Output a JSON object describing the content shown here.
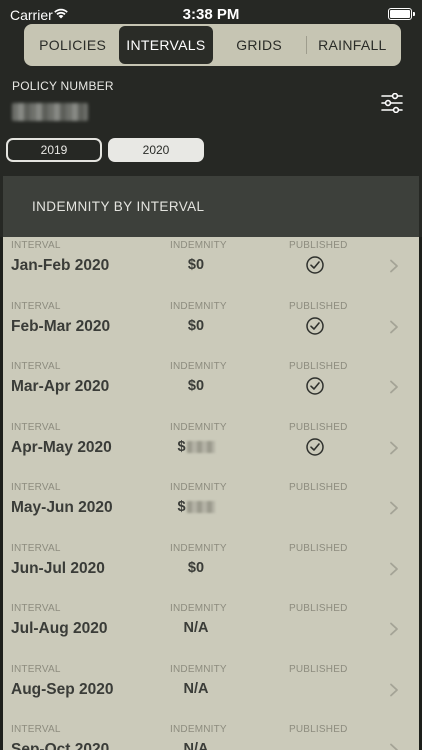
{
  "status_bar": {
    "carrier": "Carrier",
    "time": "3:38 PM"
  },
  "tabs": [
    {
      "label": "POLICIES",
      "active": false
    },
    {
      "label": "INTERVALS",
      "active": true
    },
    {
      "label": "GRIDS",
      "active": false
    },
    {
      "label": "RAINFALL",
      "active": false
    }
  ],
  "policy": {
    "label": "POLICY NUMBER",
    "value_icon": "redacted-text"
  },
  "years": [
    {
      "label": "2019",
      "selected": false
    },
    {
      "label": "2020",
      "selected": true
    }
  ],
  "section_title": "INDEMNITY BY INTERVAL",
  "columns": {
    "interval": "INTERVAL",
    "indemnity": "INDEMNITY",
    "published": "PUBLISHED"
  },
  "rows": [
    {
      "period": "Jan-Feb 2020",
      "indemnity": "$0",
      "published": true
    },
    {
      "period": "Feb-Mar 2020",
      "indemnity": "$0",
      "published": true
    },
    {
      "period": "Mar-Apr 2020",
      "indemnity": "$0",
      "published": true
    },
    {
      "period": "Apr-May 2020",
      "indemnity": "$",
      "redacted": true,
      "published": true
    },
    {
      "period": "May-Jun 2020",
      "indemnity": "$",
      "redacted": true,
      "published": false
    },
    {
      "period": "Jun-Jul 2020",
      "indemnity": "$0",
      "published": false
    },
    {
      "period": "Jul-Aug 2020",
      "indemnity": "N/A",
      "published": false
    },
    {
      "period": "Aug-Sep 2020",
      "indemnity": "N/A",
      "published": false
    },
    {
      "period": "Sep-Oct 2020",
      "indemnity": "N/A",
      "published": false
    }
  ],
  "colors": {
    "header_bg": "#262824",
    "tab_bar_bg": "#c6c5b3",
    "active_tab_bg": "#2a2c27",
    "list_bg": "#cbcaba",
    "section_bg": "#3d403b"
  }
}
